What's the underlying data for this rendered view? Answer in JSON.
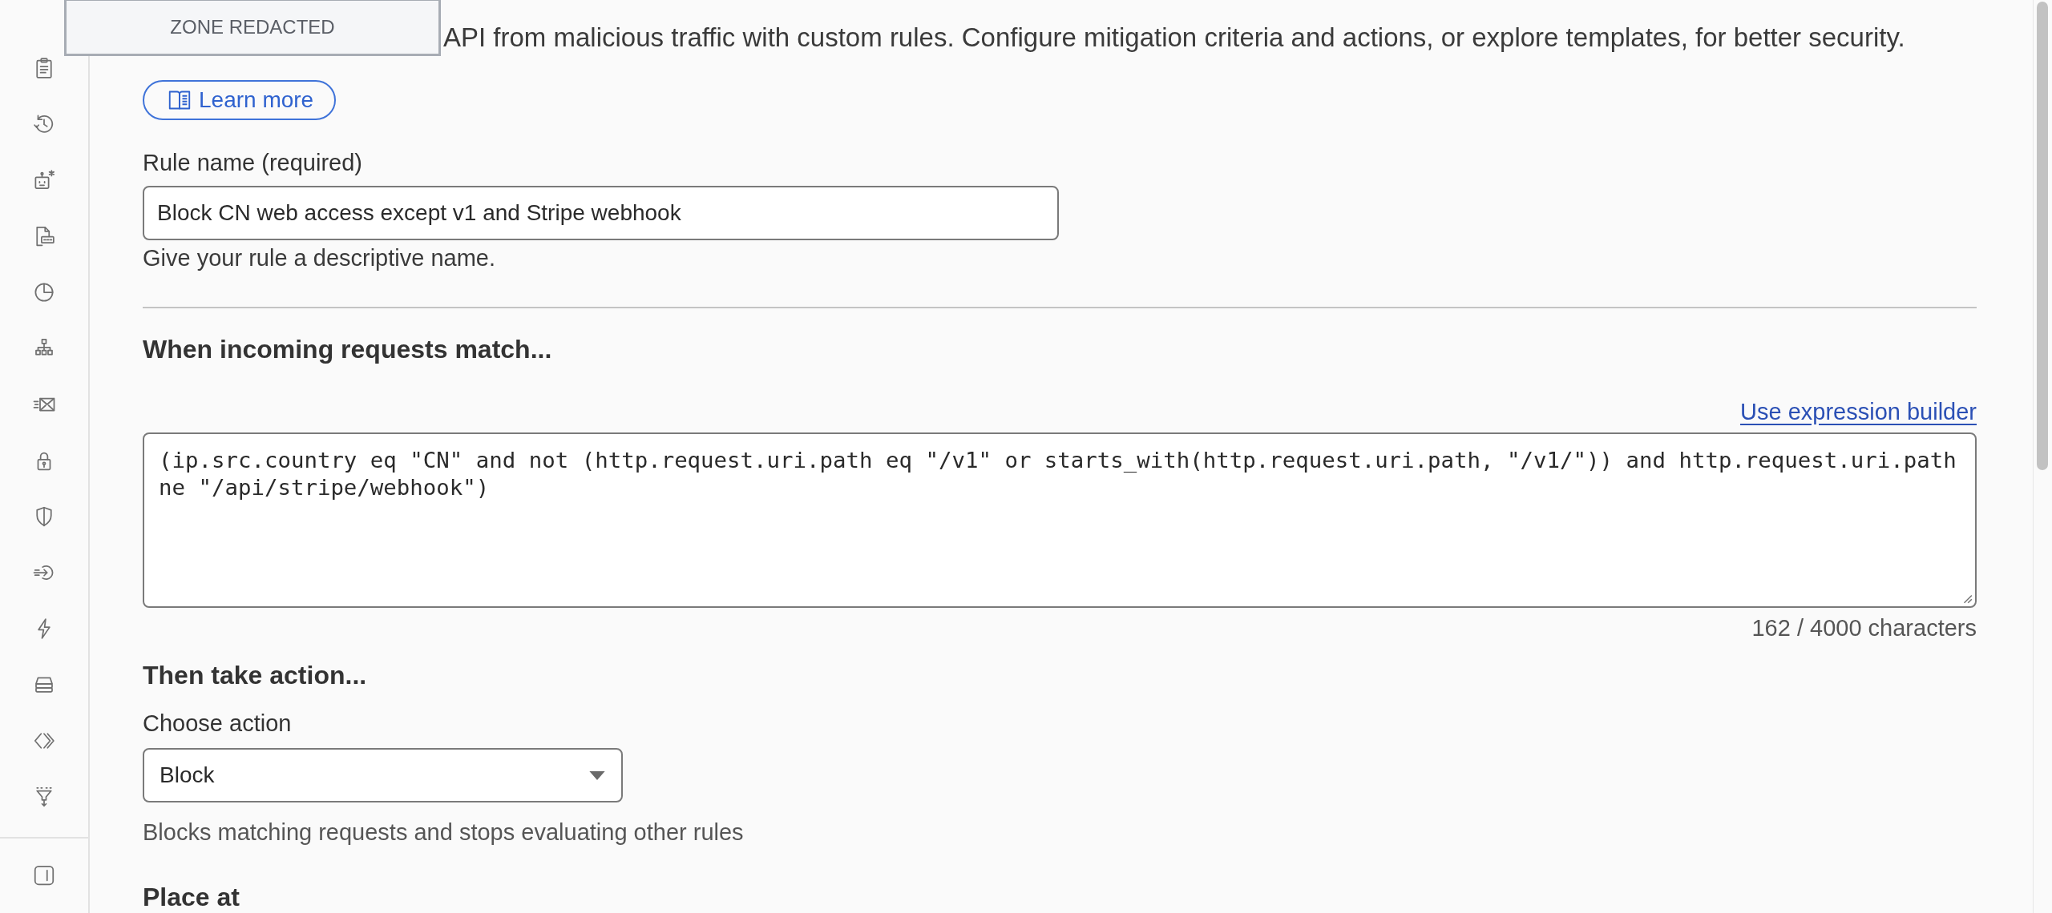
{
  "redaction": {
    "label": "ZONE REDACTED"
  },
  "intro": {
    "text": "API from malicious traffic with custom rules. Configure mitigation criteria and actions, or explore templates, for better security.",
    "learn_more": "Learn more"
  },
  "rule_name": {
    "label": "Rule name (required)",
    "value": "Block CN web access except v1 and Stripe webhook",
    "help": "Give your rule a descriptive name."
  },
  "match": {
    "heading": "When incoming requests match...",
    "builder_link": "Use expression builder",
    "expression": "(ip.src.country eq \"CN\" and not (http.request.uri.path eq \"/v1\" or starts_with(http.request.uri.path, \"/v1/\")) and http.request.uri.path ne \"/api/stripe/webhook\")",
    "char_count": "162 / 4000 characters"
  },
  "action": {
    "heading": "Then take action...",
    "label": "Choose action",
    "value": "Block",
    "help": "Blocks matching requests and stops evaluating other rules"
  },
  "placement": {
    "heading": "Place at"
  }
}
